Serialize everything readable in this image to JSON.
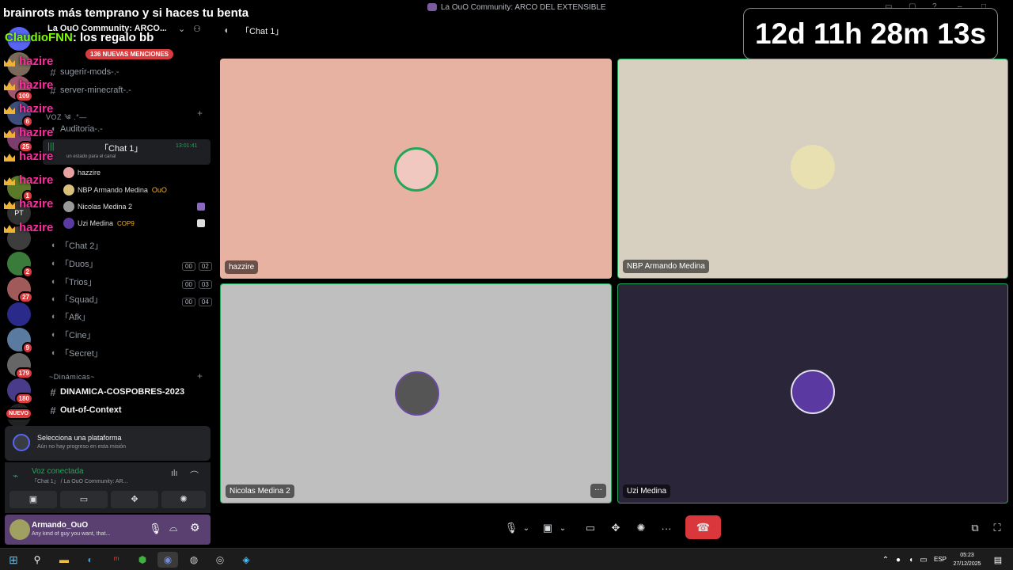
{
  "overlay": {
    "banner": "brainrots más temprano y si haces tu benta",
    "chat_user": "ClaudioFNN",
    "chat_message": ": los regalo bb",
    "timer": "12d 11h 28m 13s",
    "mention_name": "hazire"
  },
  "window": {
    "title": "La OuO Community: ARCO DEL EXTENSIBLE"
  },
  "server": {
    "name": "La OuO Community: ARCO...",
    "mentions_badge": "136 NUEVAS MENCIONES"
  },
  "guild_badges": [
    "109",
    "6",
    "25",
    "1",
    "PT",
    "2",
    "27",
    "9",
    "179",
    "180",
    "NUEVO"
  ],
  "channels": {
    "text_top": [
      {
        "name": "sugerir-mods-.-"
      },
      {
        "name": "server-minecraft-.-"
      }
    ],
    "category_voz": "VOZ ༄ .°—",
    "auditoria": "Auditoria-.-",
    "active_voice": {
      "name": "「Chat 1」",
      "time": "13:01:41",
      "status": "un estado para el canal"
    },
    "voice_users": [
      {
        "name": "hazzire",
        "extra": ""
      },
      {
        "name": "NBP Armando Medina",
        "extra": "OuO"
      },
      {
        "name": "Nicolas Medina 2",
        "extra": ""
      },
      {
        "name": "Uzi Medina",
        "extra": "COP9"
      }
    ],
    "voice_channels": [
      {
        "name": "「Chat 2」",
        "a": "",
        "b": ""
      },
      {
        "name": "「Duos」",
        "a": "00",
        "b": "02"
      },
      {
        "name": "「Trios」",
        "a": "00",
        "b": "03"
      },
      {
        "name": "「Squad」",
        "a": "00",
        "b": "04"
      },
      {
        "name": "「Afk」",
        "a": "",
        "b": ""
      },
      {
        "name": "「Cine」",
        "a": "",
        "b": ""
      },
      {
        "name": "「Secret」",
        "a": "",
        "b": ""
      }
    ],
    "category_dinamicas": "~Dinámicas~",
    "text_bottom": [
      {
        "name": "DINAMICA-COSPOBRES-2023"
      },
      {
        "name": "Out-of-Context"
      }
    ]
  },
  "quest": {
    "title": "Selecciona una plataforma",
    "subtitle": "Aún no hay progreso en esta misión"
  },
  "voice_panel": {
    "status": "Voz conectada",
    "detail": "「Chat 1」 / La OuO Community: AR..."
  },
  "user_panel": {
    "name": "Armando_OuO",
    "status": "Any kind of guy you want, that..."
  },
  "call": {
    "header_channel": "「Chat 1」",
    "tiles": [
      {
        "name": "hazzire",
        "bg": "#e8b2a2"
      },
      {
        "name": "NBP Armando Medina",
        "bg": "#d7d0c0"
      },
      {
        "name": "Nicolas Medina 2",
        "bg": "#bfbfbf"
      },
      {
        "name": "Uzi Medina",
        "bg": "#2a2538"
      }
    ]
  },
  "taskbar": {
    "lang": "ESP",
    "time": "05:23",
    "date": "27/12/2025"
  },
  "colors": {
    "accent_green": "#23a55a",
    "hangup_red": "#da373c",
    "mention_pink": "#ff2c9e"
  }
}
